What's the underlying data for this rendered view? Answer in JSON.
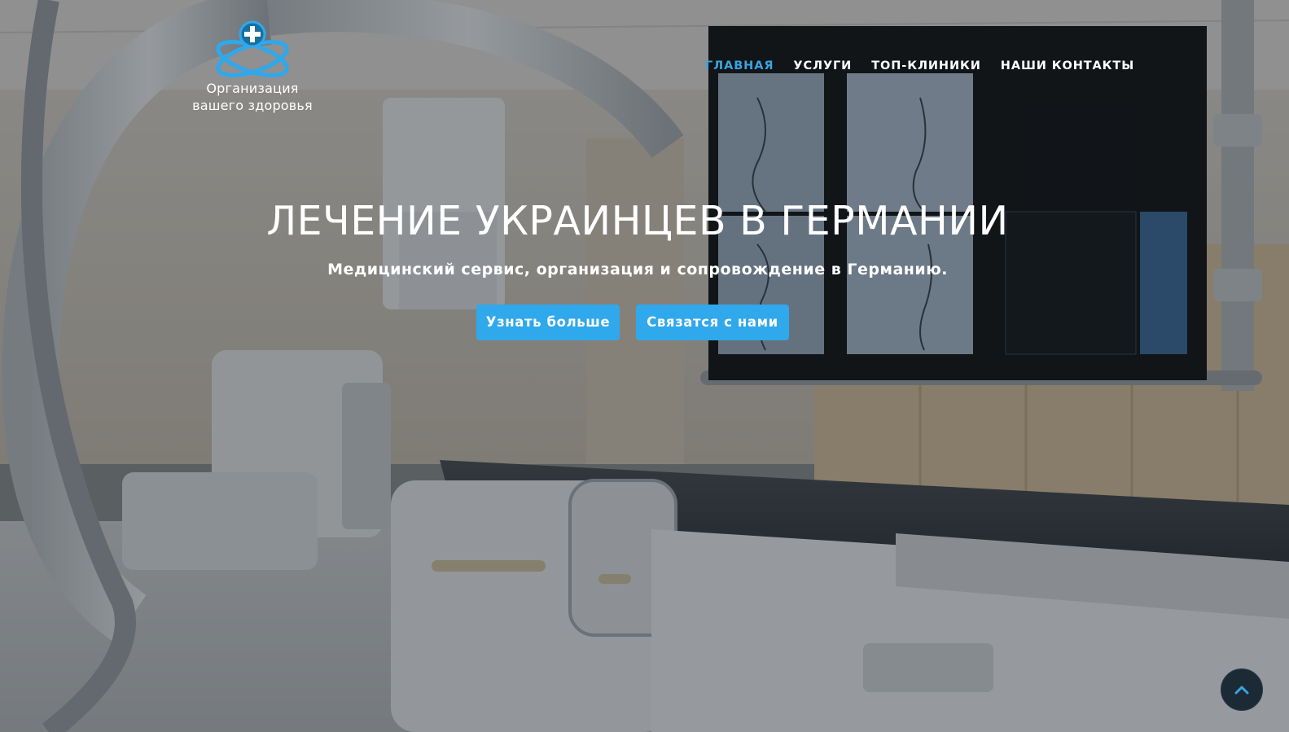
{
  "brand": {
    "name_line1": "Организация",
    "name_line2": "вашего здоровья",
    "logo_icon": "medical-cross-orbit-logo",
    "accent_color": "#2fa8ec"
  },
  "nav": {
    "items": [
      {
        "label": "ГЛАВНАЯ",
        "active": true
      },
      {
        "label": "УСЛУГИ",
        "active": false
      },
      {
        "label": "ТОП-КЛИНИКИ",
        "active": false
      },
      {
        "label": "НАШИ КОНТАКТЫ",
        "active": false
      }
    ],
    "active_color": "#3aa4e0"
  },
  "hero": {
    "title": "ЛЕЧЕНИЕ УКРАИНЦЕВ В ГЕРМАНИИ",
    "subtitle": "Медицинский сервис, организация и сопровождение в Германию.",
    "background_icon": "angiography-room-photo",
    "buttons": {
      "learn_more": "Узнать больше",
      "contact_us": "Связатся с нами"
    }
  },
  "scroll_top": {
    "icon": "chevron-up-icon"
  }
}
